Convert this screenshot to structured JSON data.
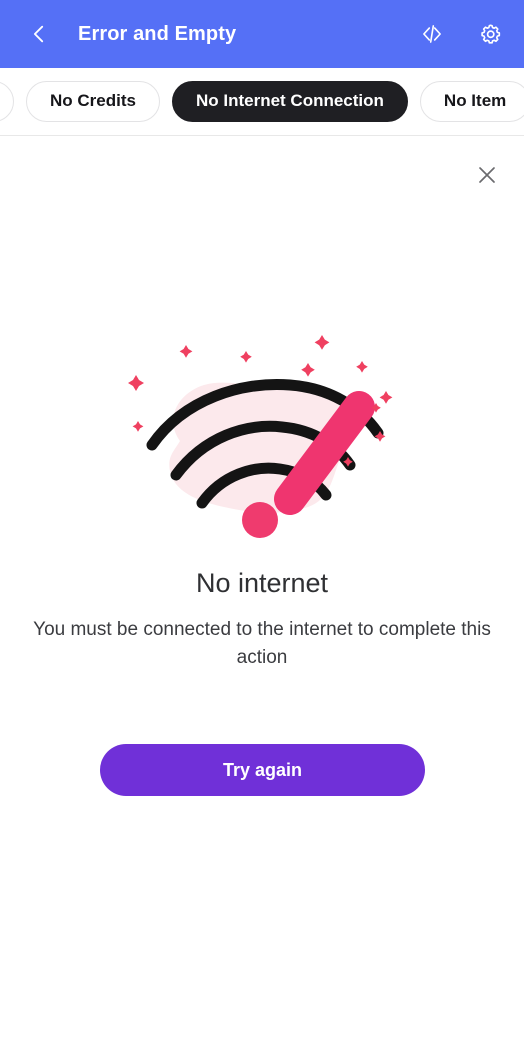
{
  "header": {
    "title": "Error and Empty",
    "back_icon": "chevron-left-icon",
    "code_icon": "code-icon",
    "settings_icon": "gear-icon",
    "background_color": "#5570f6"
  },
  "chips": [
    {
      "label": "",
      "active": false,
      "clipped": true
    },
    {
      "label": "No Credits",
      "active": false,
      "clipped": false
    },
    {
      "label": "No Internet Connection",
      "active": true,
      "clipped": false
    },
    {
      "label": "No Item",
      "active": false,
      "clipped": false
    }
  ],
  "content": {
    "close_icon": "close-icon",
    "illustration": {
      "name": "no-internet-wifi-illustration",
      "blob_color": "#fce9ec",
      "arc_color": "#141414",
      "accent_color": "#ef356f",
      "sparkle_color": "#ef4060"
    },
    "title": "No internet",
    "description": "You must be connected to the internet to complete this action",
    "cta_label": "Try again",
    "cta_color": "#7030d8"
  }
}
